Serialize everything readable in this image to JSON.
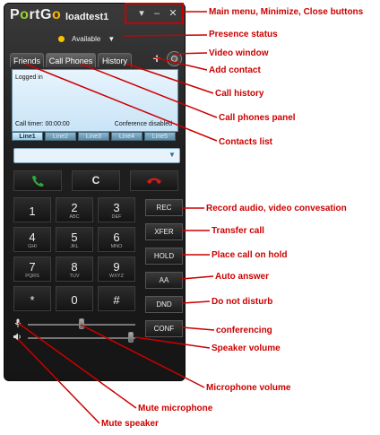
{
  "app": {
    "logo_left": "P",
    "logo_o": "o",
    "logo_mid": "rtG",
    "logo_o2": "o",
    "username": "loadtest1"
  },
  "window_buttons": {
    "menu": "▾",
    "minimize": "–",
    "close": "✕"
  },
  "presence": {
    "status": "Available"
  },
  "tabs": [
    "Friends",
    "Call Phones",
    "History"
  ],
  "screen": {
    "status": "Logged in",
    "timer": "Call timer: 00:00:00",
    "conference": "Conference disabled"
  },
  "lines": [
    "Line1",
    "Line2",
    "Line3",
    "Line4",
    "Line5"
  ],
  "controls": {
    "clear": "C"
  },
  "keypad": [
    {
      "digit": "1",
      "letters": ""
    },
    {
      "digit": "2",
      "letters": "ABC"
    },
    {
      "digit": "3",
      "letters": "DEF"
    },
    {
      "digit": "4",
      "letters": "GHI"
    },
    {
      "digit": "5",
      "letters": "JKL"
    },
    {
      "digit": "6",
      "letters": "MNO"
    },
    {
      "digit": "7",
      "letters": "PQRS"
    },
    {
      "digit": "8",
      "letters": "TUV"
    },
    {
      "digit": "9",
      "letters": "WXYZ"
    },
    {
      "digit": "*",
      "letters": ""
    },
    {
      "digit": "0",
      "letters": ""
    },
    {
      "digit": "#",
      "letters": ""
    }
  ],
  "function_buttons": [
    "REC",
    "XFER",
    "HOLD",
    "AA",
    "DND",
    "CONF"
  ],
  "sliders": {
    "microphone_volume": 0.5,
    "speaker_volume": 0.96
  },
  "icons": {
    "call": "phone-answer-icon",
    "hangup": "phone-hangup-icon",
    "mic": "microphone-icon",
    "speaker": "speaker-icon",
    "video": "video-icon",
    "add": "plus-icon"
  },
  "colors": {
    "callout": "#cc0000",
    "logo_accent": "#9bd12f",
    "presence": "#f5c400",
    "call_green": "#2fa63a",
    "hangup_red": "#d41a1a"
  },
  "callouts": {
    "main_menu": "Main menu, Minimize, Close buttons",
    "presence": "Presence status",
    "video": "Video window",
    "add_contact": "Add contact",
    "call_history": "Call history",
    "call_phones": "Call phones panel",
    "contacts": "Contacts list",
    "record": "Record audio, video convesation",
    "transfer": "Transfer call",
    "hold": "Place call on hold",
    "auto_answer": "Auto answer",
    "dnd": "Do not disturb",
    "conferencing": "conferencing",
    "speaker_volume": "Speaker volume",
    "mic_volume": "Microphone volume",
    "mute_mic": "Mute microphone",
    "mute_speaker": "Mute speaker"
  }
}
